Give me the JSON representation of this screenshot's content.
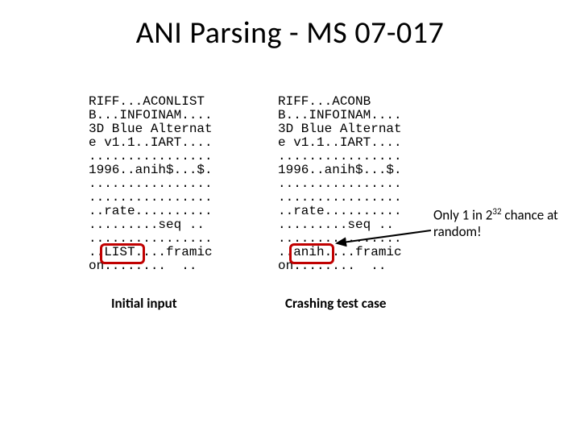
{
  "title": "ANI Parsing - MS 07-017",
  "hex_left": "RIFF...ACONLIST\nB...INFOINAM....\n3D Blue Alternat\ne v1.1..IART....\n................\n1996..anih$...$.\n................\n................\n..rate..........\n.........seq ..\n................\n..LIST....framic\non........  ..",
  "hex_right": "RIFF...ACONB\nB...INFOINAM....\n3D Blue Alternat\ne v1.1..IART....\n................\n1996..anih$...$.\n................\n................\n..rate..........\n.........seq ..\n................\n..anih....framic\non........  ..",
  "caption_left": "Initial input",
  "caption_right": "Crashing test case",
  "note_before": "Only 1 in 2",
  "note_exp": "32",
  "note_after": " chance at random!"
}
